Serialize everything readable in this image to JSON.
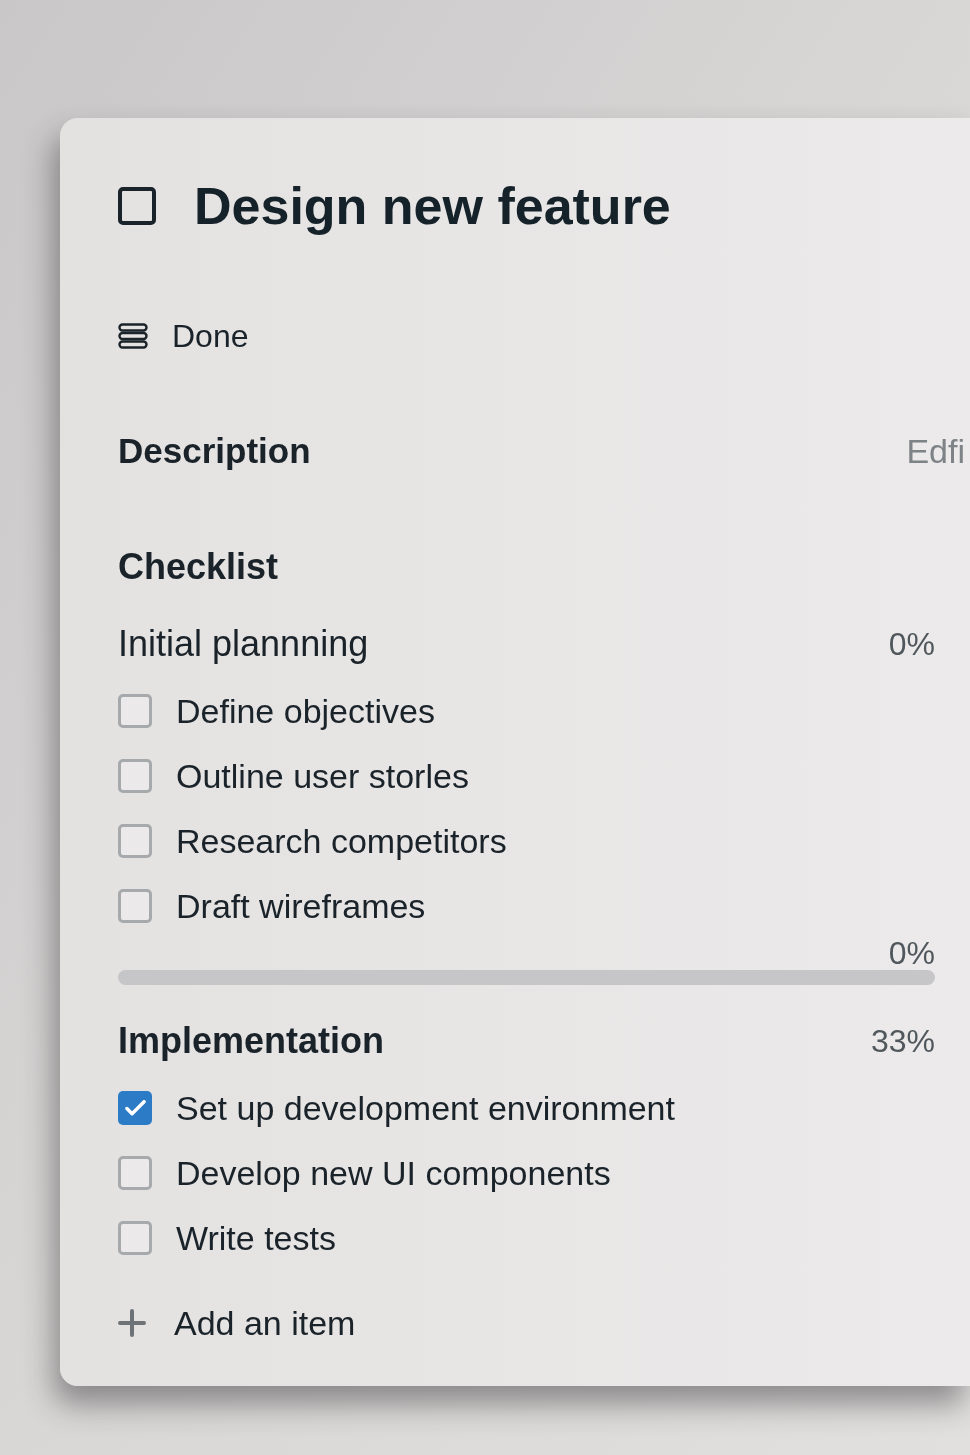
{
  "card": {
    "title": {
      "text": "Design new feature",
      "checked": false
    },
    "status": {
      "label": "Done"
    },
    "description": {
      "heading": "Description",
      "action": "Edfi"
    },
    "checklist": {
      "heading": "Checklist",
      "groups": [
        {
          "title": "Initial plannning",
          "percent": "0%",
          "items": [
            {
              "label": "Define objectives",
              "checked": false
            },
            {
              "label": "Outline user storles",
              "checked": false
            },
            {
              "label": "Research competitors",
              "checked": false
            },
            {
              "label": "Draft wireframes",
              "checked": false
            }
          ],
          "progress": {
            "reading": "0%",
            "level": 0
          }
        },
        {
          "title": "Implementation",
          "percent": "33%",
          "items": [
            {
              "label": "Set up development environment",
              "checked": true
            },
            {
              "label": "Develop new UI components",
              "checked": false
            },
            {
              "label": "Write tests",
              "checked": false
            }
          ]
        }
      ],
      "add_item": "Add an item"
    }
  }
}
